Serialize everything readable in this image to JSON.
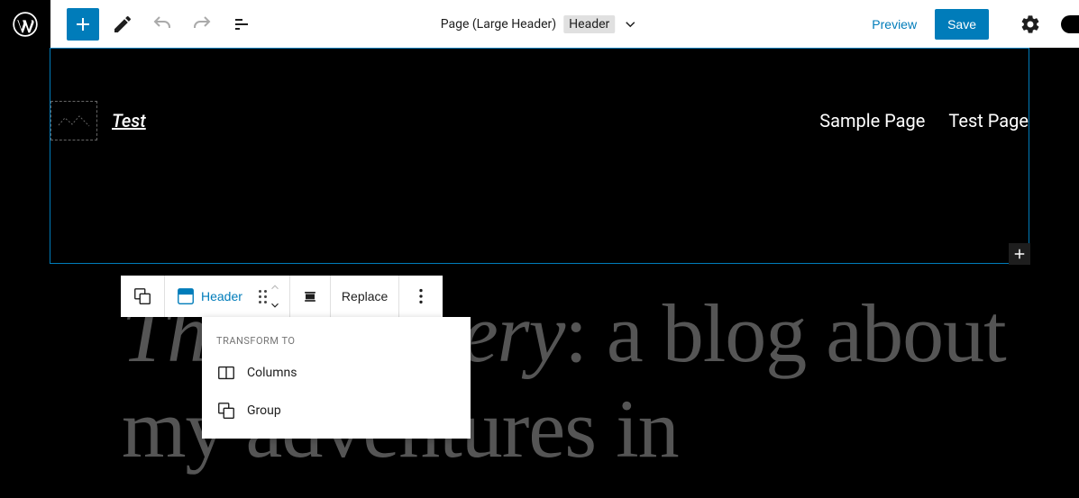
{
  "topbar": {
    "page_label": "Page (Large Header)",
    "template_part": "Header",
    "preview": "Preview",
    "save": "Save"
  },
  "header_block": {
    "site_title": "Test",
    "nav": [
      "Sample Page",
      "Test Page"
    ]
  },
  "block_toolbar": {
    "type_label": "Header",
    "replace": "Replace"
  },
  "popover": {
    "title": "Transform to",
    "items": [
      {
        "icon": "columns",
        "label": "Columns"
      },
      {
        "icon": "group",
        "label": "Group"
      }
    ]
  },
  "article": {
    "title_italic": "The Hatchery",
    "rest": ": a blog about my adventures in"
  }
}
